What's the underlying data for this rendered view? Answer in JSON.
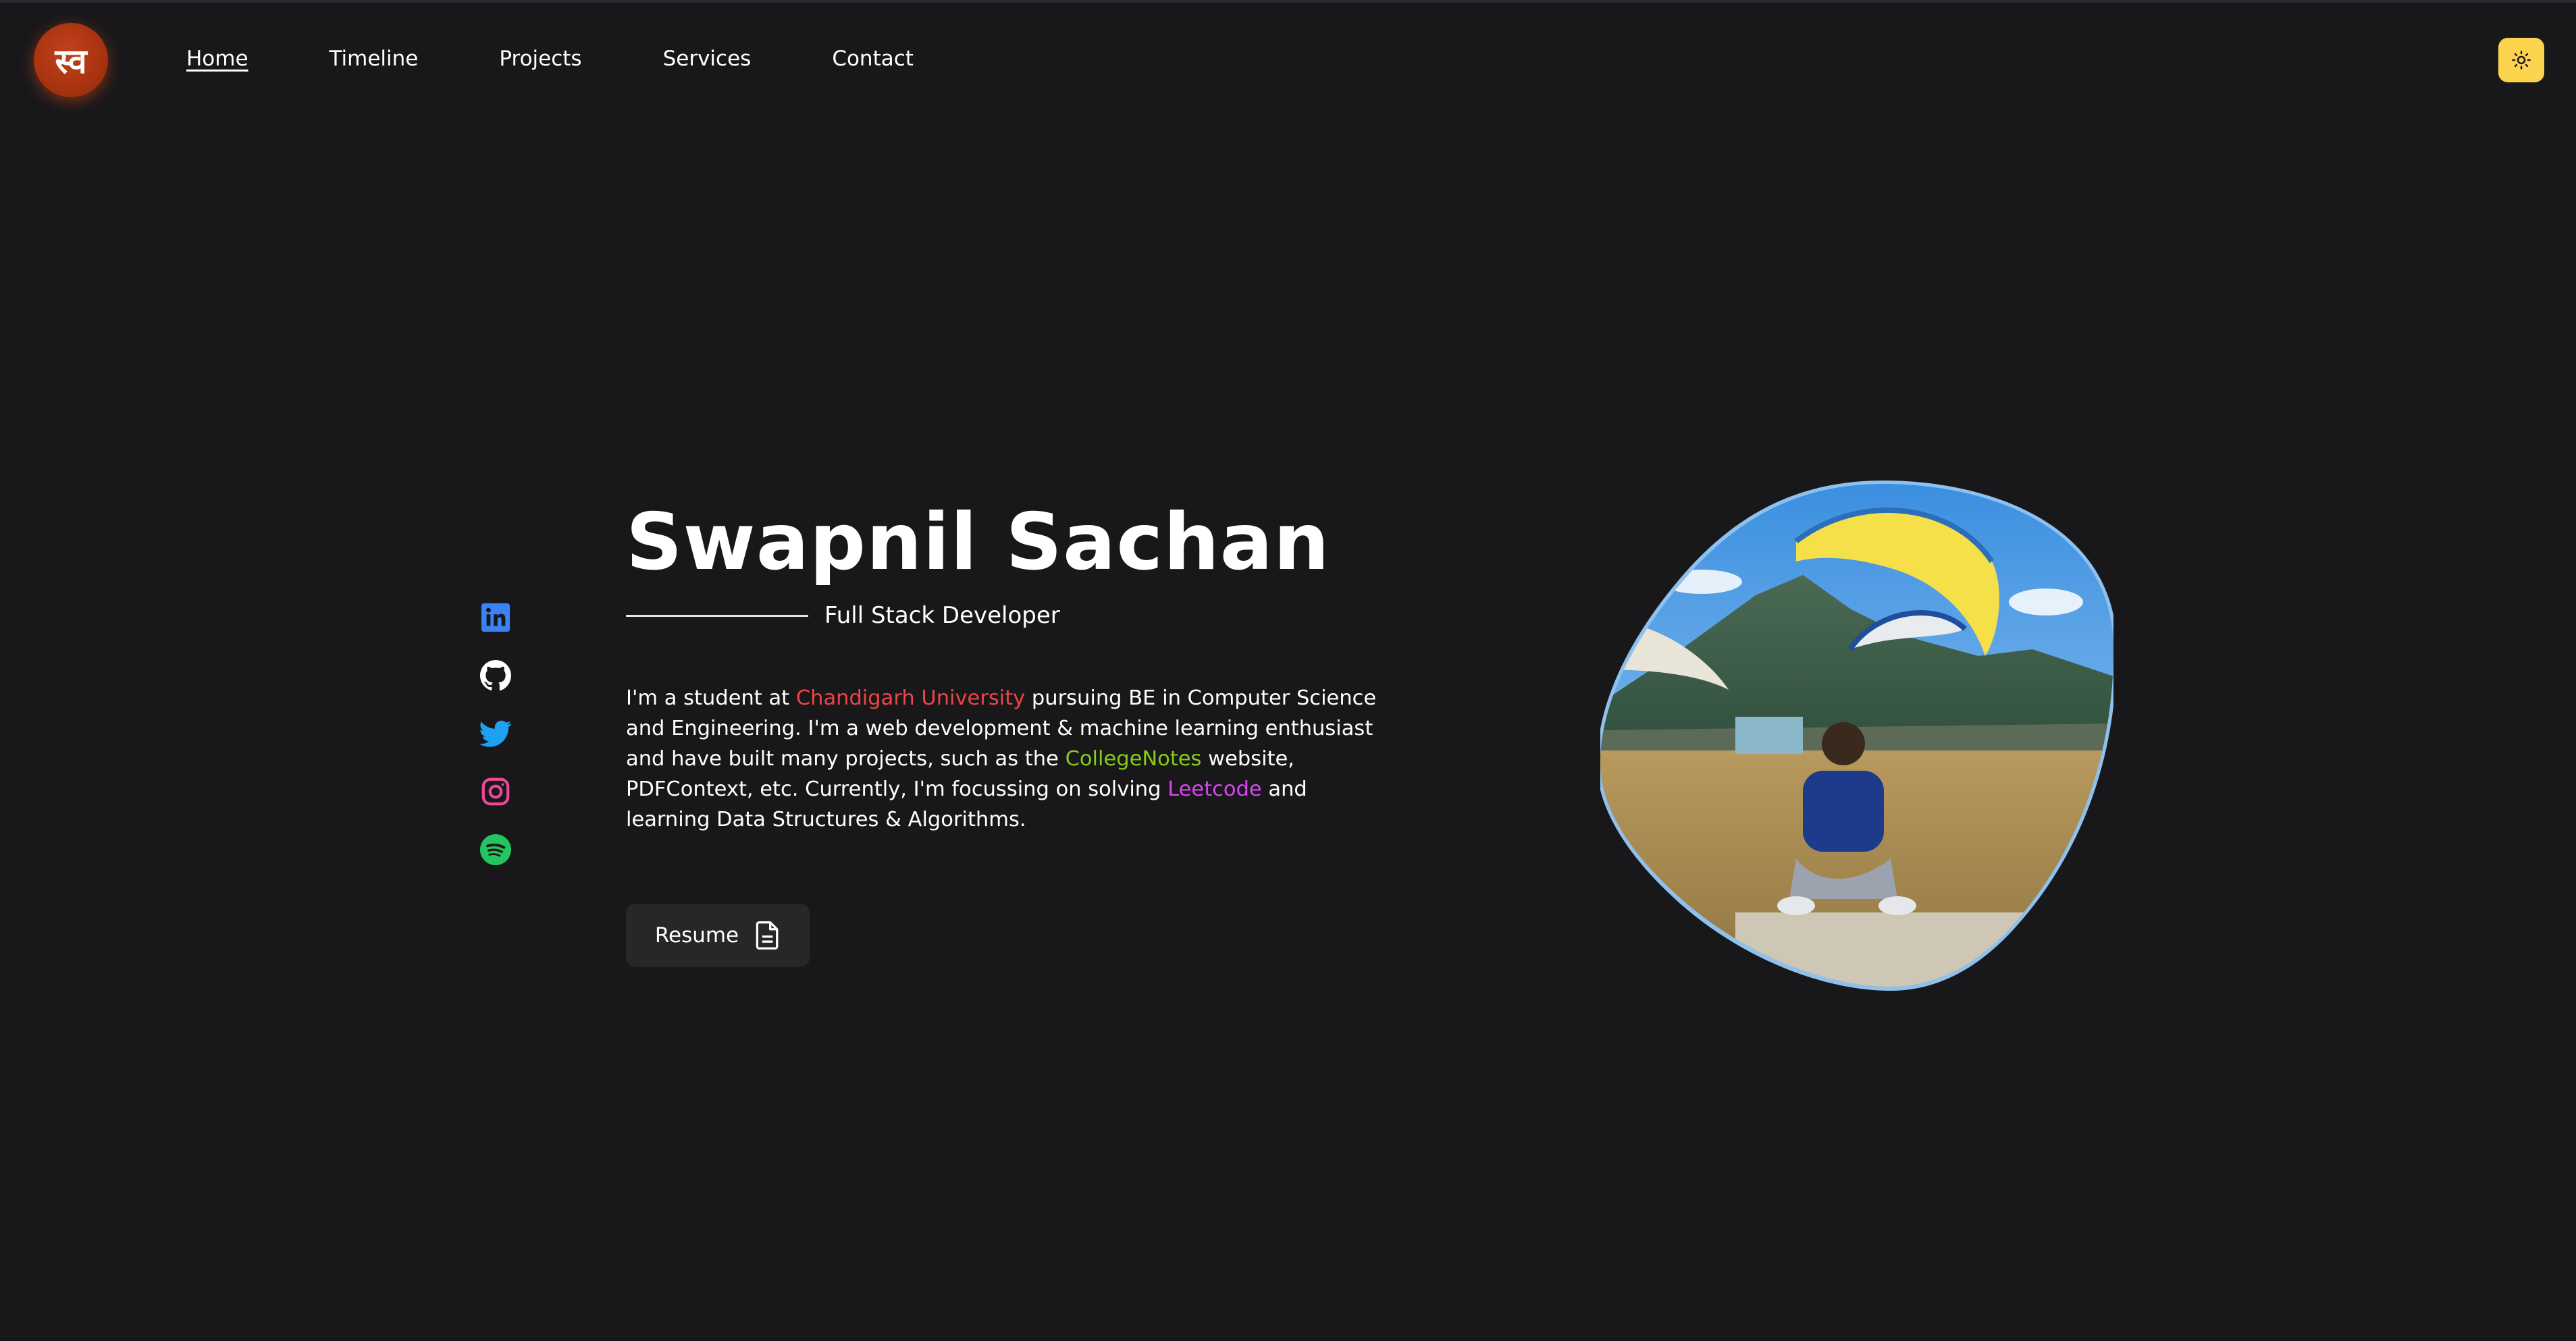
{
  "header": {
    "logo_text": "स्व",
    "nav": [
      {
        "label": "Home",
        "active": true
      },
      {
        "label": "Timeline",
        "active": false
      },
      {
        "label": "Projects",
        "active": false
      },
      {
        "label": "Services",
        "active": false
      },
      {
        "label": "Contact",
        "active": false
      }
    ],
    "theme_toggle_icon": "sun-icon"
  },
  "social": [
    {
      "name": "linkedin-icon",
      "color": "#3b82f6"
    },
    {
      "name": "github-icon",
      "color": "#ffffff"
    },
    {
      "name": "twitter-icon",
      "color": "#1da1f2"
    },
    {
      "name": "instagram-icon",
      "color": "#ec4899"
    },
    {
      "name": "spotify-icon",
      "color": "#22c55e"
    }
  ],
  "intro": {
    "name": "Swapnil Sachan",
    "role": "Full Stack Developer",
    "bio": {
      "p1": "I'm a student at ",
      "university": "Chandigarh University",
      "p2": " pursuing BE in Computer Science and Engineering. I'm a web development & machine learning enthusiast and have built many projects, such as the ",
      "project": "CollegeNotes",
      "p3": " website, PDFContext, etc. Currently, I'm focussing on solving ",
      "platform": "Leetcode",
      "p4": " and learning Data Structures & Algorithms."
    },
    "resume_label": "Resume"
  },
  "colors": {
    "background": "#18181b",
    "accent_red": "#ef4444",
    "accent_green": "#84cc16",
    "accent_purple": "#d946ef",
    "toggle_bg": "#fcd34d",
    "logo_bg": "#a8330f"
  }
}
